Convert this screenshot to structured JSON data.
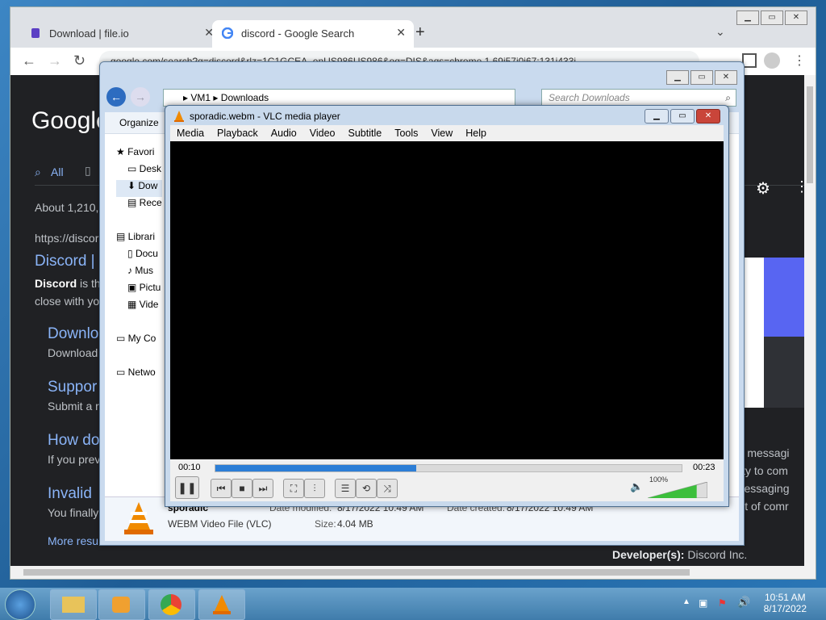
{
  "chrome": {
    "tabs": [
      {
        "title": "Download | file.io",
        "close": "✕"
      },
      {
        "title": "discord - Google Search",
        "close": "✕"
      }
    ],
    "new_tab": "+",
    "url": "google.com/search?q=discord&rlz=1C1GCEA_enUS986US986&oq=DIS&aqs=chrome.1.69i57j0i67:131i433i...",
    "google": {
      "logo": "Google",
      "all_tab": "All",
      "about": "About 1,210,",
      "result_url": "https://discor",
      "result_title": "Discord |",
      "snippet1_bold": "Discord",
      "snippet1_rest": " is th",
      "snippet2": "close with yo",
      "sub1_title": "Downlo",
      "sub1_text": "Download",
      "sub2_title": "Suppor",
      "sub2_text": "Submit a r",
      "sub3_title": "How do",
      "sub3_text": "If you prev",
      "sub4_title": "Invalid",
      "sub4_text": "You finally",
      "more": "More resu",
      "right1": "ant messagi",
      "right2": "bility to com",
      "right3": "t messaging",
      "right4": "part of comr",
      "developer_label": "Developer(s):",
      "developer_value": "Discord Inc."
    }
  },
  "explorer": {
    "path_root": "VM1",
    "path_folder": "Downloads",
    "search_placeholder": "Search Downloads",
    "organize": "Organize",
    "tree": [
      "Favori",
      "Desk",
      "Dow",
      "Rece",
      "Librari",
      "Docu",
      "Mus",
      "Pictu",
      "Vide",
      "My Co",
      "Netwo"
    ],
    "file_name": "sporadic",
    "file_type": "WEBM Video File (VLC)",
    "date_modified_label": "Date modified:",
    "date_modified": "8/17/2022 10:49 AM",
    "date_created_label": "Date created:",
    "date_created": "8/17/2022 10:49 AM",
    "size_label": "Size:",
    "size": "4.04 MB"
  },
  "vlc": {
    "title": "sporadic.webm - VLC media player",
    "menu": [
      "Media",
      "Playback",
      "Audio",
      "Video",
      "Subtitle",
      "Tools",
      "View",
      "Help"
    ],
    "elapsed": "00:10",
    "total": "00:23",
    "progress_percent": 43,
    "volume_label": "100%",
    "volume_percent": 100
  },
  "taskbar": {
    "time": "10:51 AM",
    "date": "8/17/2022"
  },
  "colors": {
    "google_bg": "#202124",
    "google_link": "#8ab4f8",
    "vlc_seek": "#2c7ed6"
  }
}
